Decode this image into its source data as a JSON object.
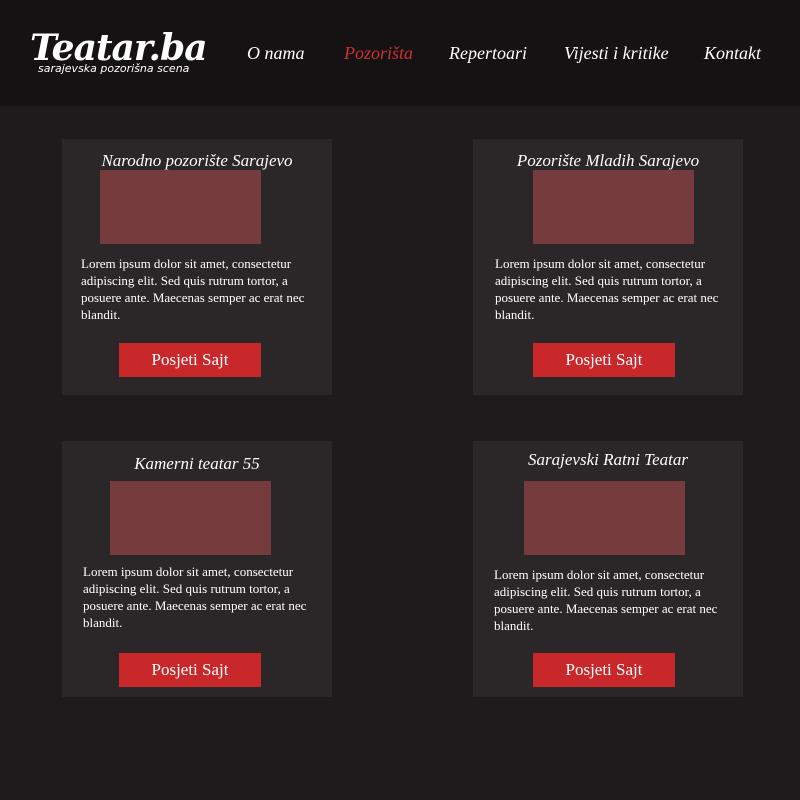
{
  "header": {
    "logo_title": "Teatar.ba",
    "logo_tagline": "sarajevska pozorišna scena",
    "nav": [
      {
        "label": "O nama",
        "active": false
      },
      {
        "label": "Pozorišta",
        "active": true
      },
      {
        "label": "Repertoari",
        "active": false
      },
      {
        "label": "Vijesti i kritike",
        "active": false
      },
      {
        "label": "Kontakt",
        "active": false
      }
    ]
  },
  "theaters": [
    {
      "name": "Narodno pozorište Sarajevo",
      "description": "Lorem ipsum dolor sit amet, consectetur adipiscing elit. Sed quis rutrum tortor, a posuere ante. Maecenas semper ac erat nec blandit.",
      "button_label": "Posjeti Sajt"
    },
    {
      "name": "Pozorište Mladih Sarajevo",
      "description": "Lorem ipsum dolor sit amet, consectetur adipiscing elit. Sed quis rutrum tortor, a posuere ante. Maecenas semper ac erat nec blandit.",
      "button_label": "Posjeti Sajt"
    },
    {
      "name": "Kamerni teatar 55",
      "description": "Lorem ipsum dolor sit amet, consectetur adipiscing elit. Sed quis rutrum tortor, a posuere ante. Maecenas semper ac erat nec blandit.",
      "button_label": "Posjeti Sajt"
    },
    {
      "name": "Sarajevski Ratni Teatar",
      "description": "Lorem ipsum dolor sit amet, consectetur adipiscing elit. Sed quis rutrum tortor, a posuere ante. Maecenas semper ac erat nec blandit.",
      "button_label": "Posjeti Sajt"
    }
  ],
  "colors": {
    "page_background": "#1e1b1c",
    "header_background": "#141213",
    "card_background": "#2b2729",
    "image_placeholder": "#763c3d",
    "accent": "#c9282b",
    "active_nav": "#cf2f33",
    "text": "#ffffff"
  }
}
